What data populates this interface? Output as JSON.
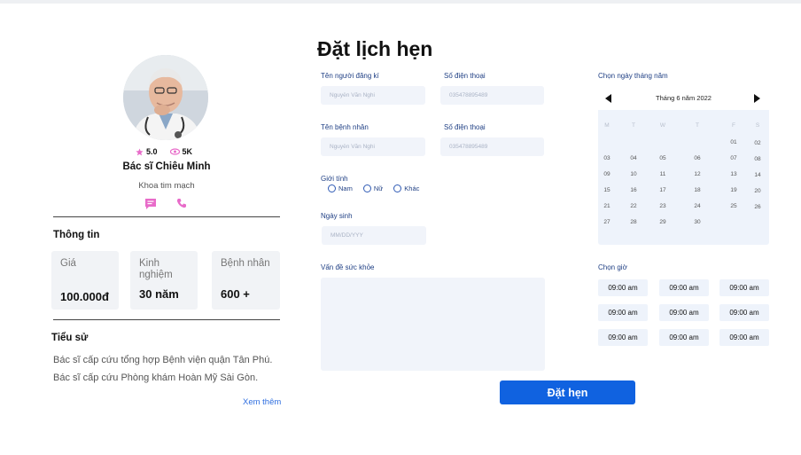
{
  "doctor": {
    "rating": "5.0",
    "views": "5K",
    "name": "Bác sĩ Chiêu Minh",
    "department": "Khoa tim mạch"
  },
  "info": {
    "title": "Thông tin",
    "cards": [
      {
        "label": "Giá",
        "value": "100.000đ"
      },
      {
        "label": "Kinh nghiệm",
        "value": "30 năm"
      },
      {
        "label": "Bệnh nhân",
        "value": "600 +"
      }
    ]
  },
  "history": {
    "title": "Tiểu sử",
    "lines": [
      "Bác sĩ cấp cứu tổng hợp Bệnh viện quận Tân Phú.",
      "Bác sĩ cấp cứu Phòng khám Hoàn Mỹ Sài Gòn."
    ],
    "more": "Xem thêm"
  },
  "form": {
    "title": "Đặt lịch hẹn",
    "registrant_label": "Tên người đăng kí",
    "registrant_placeholder": "Nguyễn Văn Nghi",
    "phone1_label": "Số điện thoại",
    "phone1_placeholder": "035478895489",
    "patient_label": "Tên bệnh nhân",
    "patient_placeholder": "Nguyễn Văn Nghi",
    "phone2_label": "Số điện thoại",
    "phone2_placeholder": "035478895489",
    "gender_label": "Giới tính",
    "gender_options": [
      "Nam",
      "Nữ",
      "Khác"
    ],
    "dob_label": "Ngày sinh",
    "dob_placeholder": "MM/DD/YYY",
    "health_label": "Vấn đề sức khỏe",
    "submit": "Đặt hẹn"
  },
  "calendar": {
    "label": "Chọn ngày tháng năm",
    "month_title": "Tháng  6 năm 2022",
    "weekdays": [
      "M",
      "T",
      "W",
      "T",
      "F",
      "S",
      "S"
    ],
    "weeks": [
      [
        "",
        "",
        "",
        "",
        "01",
        "02"
      ],
      [
        "03",
        "04",
        "05",
        "06",
        "07",
        "08"
      ],
      [
        "09",
        "10",
        "11",
        "12",
        "13",
        "14"
      ],
      [
        "15",
        "16",
        "17",
        "18",
        "19",
        "20"
      ],
      [
        "21",
        "22",
        "23",
        "24",
        "25",
        "26"
      ],
      [
        "27",
        "28",
        "29",
        "30",
        "",
        ""
      ]
    ]
  },
  "time": {
    "label": "Chọn giờ",
    "slots": [
      "09:00 am",
      "09:00 am",
      "09:00 am",
      "09:00 am",
      "09:00 am",
      "09:00 am",
      "09:00 am",
      "09:00 am",
      "09:00 am"
    ]
  },
  "colors": {
    "accent": "#1062e0",
    "icon_pink": "#e86bc9",
    "label_blue": "#1f3f84"
  }
}
